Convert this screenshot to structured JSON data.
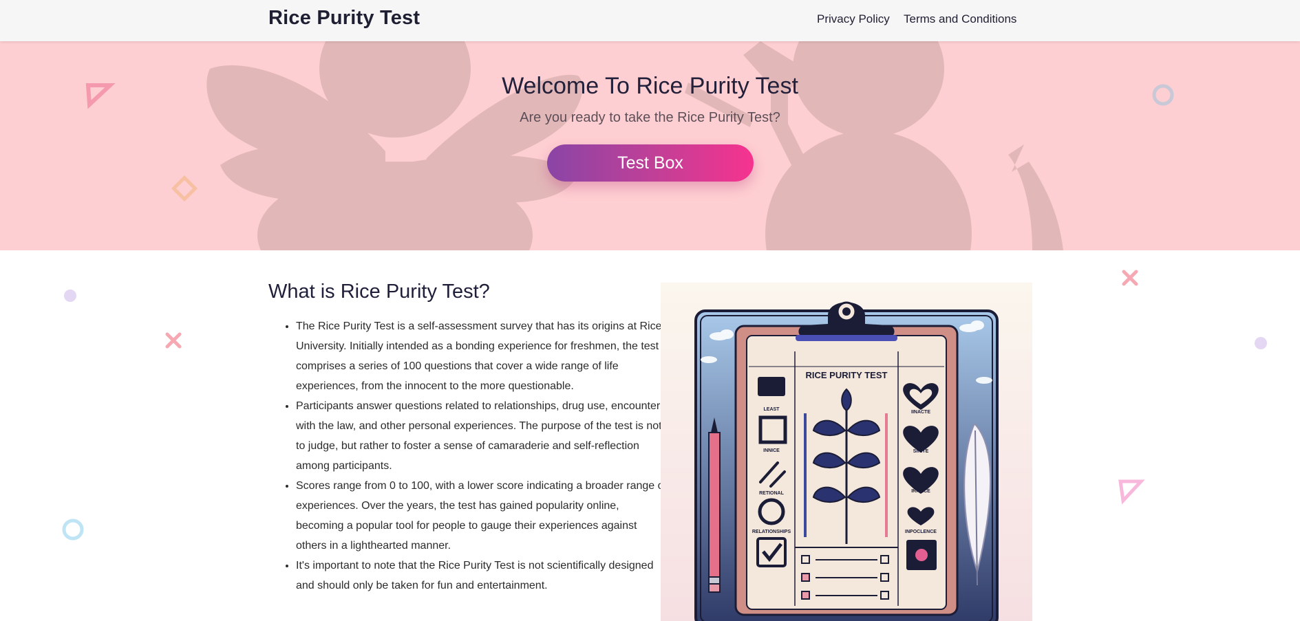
{
  "nav": {
    "brand": "Rice Purity Test",
    "links": [
      "Privacy Policy",
      "Terms and Conditions"
    ]
  },
  "hero": {
    "title": "Welcome To Rice Purity Test",
    "subtitle": "Are you ready to take the Rice Purity Test?",
    "button": "Test Box"
  },
  "about": {
    "title": "What is Rice Purity Test?",
    "items": [
      "The Rice Purity Test is a self-assessment survey that has its origins at Rice University. Initially intended as a bonding experience for freshmen, the test comprises a series of 100 questions that cover a wide range of life experiences, from the innocent to the more questionable.",
      "Participants answer questions related to relationships, drug use, encounters with the law, and other personal experiences. The purpose of the test is not to judge, but rather to foster a sense of camaraderie and self-reflection among participants.",
      "Scores range from 0 to 100, with a lower score indicating a broader range of experiences. Over the years, the test has gained popularity online, becoming a popular tool for people to gauge their experiences against others in a lighthearted manner.",
      "It's important to note that the Rice Purity Test is not scientifically designed and should only be taken for fun and entertainment."
    ]
  },
  "illustration": {
    "title": "RICE PURITY TEST",
    "left_labels": [
      "LEAST",
      "INNICE",
      "RETIONAL",
      "RELATIONSHIPS"
    ],
    "right_labels": [
      "IINACTE",
      "SINITE",
      "IRITECE",
      "INPOCLENCE"
    ]
  },
  "colors": {
    "hero_bg": "#fecfd2",
    "button_gradient_start": "#8a45a6",
    "button_gradient_end": "#f6338f",
    "nav_bg": "#f6f6f6"
  }
}
